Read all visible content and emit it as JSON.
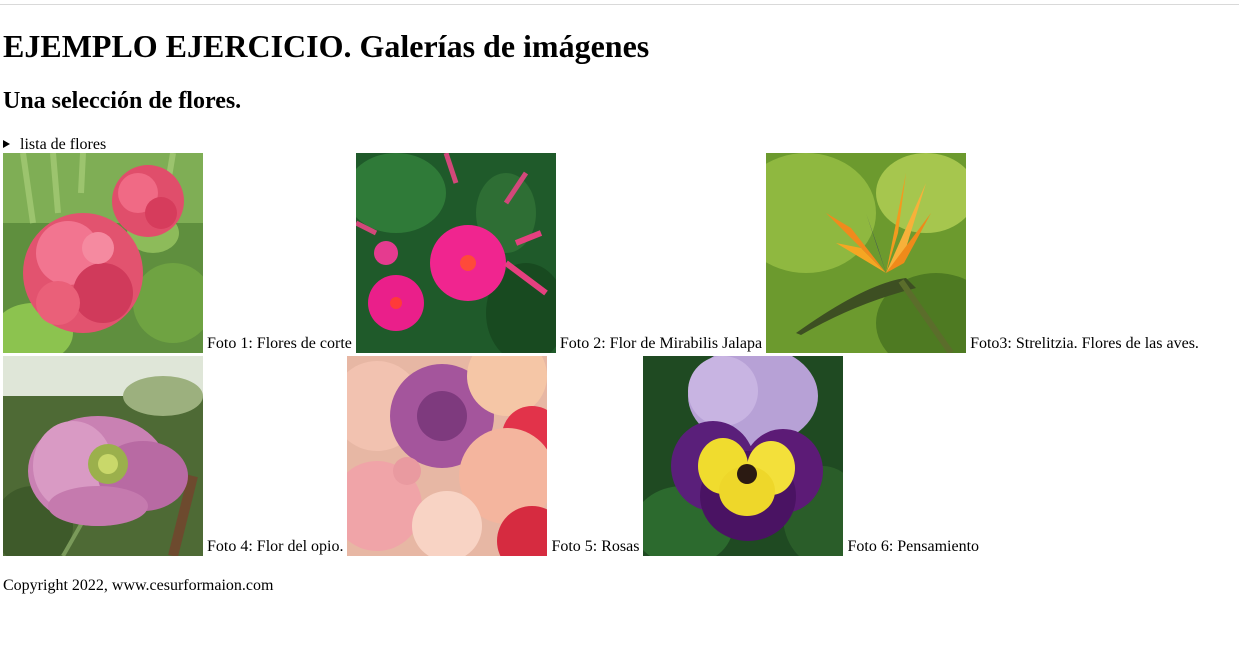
{
  "page": {
    "title": "EJEMPLO EJERCICIO. Galerías de imágenes",
    "subtitle": "Una selección de flores.",
    "details_summary": "lista de flores",
    "footer": "Copyright 2022, www.cesurformaion.com"
  },
  "gallery": [
    {
      "caption": "Foto 1: Flores de corte",
      "image": "pink-hydrangea"
    },
    {
      "caption": "Foto 2: Flor de Mirabilis Jalapa",
      "image": "magenta-mirabilis"
    },
    {
      "caption": "Foto3: Strelitzia. Flores de las aves.",
      "image": "orange-strelitzia"
    },
    {
      "caption": "Foto 4: Flor del opio.",
      "image": "lilac-poppy"
    },
    {
      "caption": "Foto 5: Rosas",
      "image": "rose-bouquet"
    },
    {
      "caption": "Foto 6: Pensamiento",
      "image": "purple-yellow-pansy"
    }
  ]
}
